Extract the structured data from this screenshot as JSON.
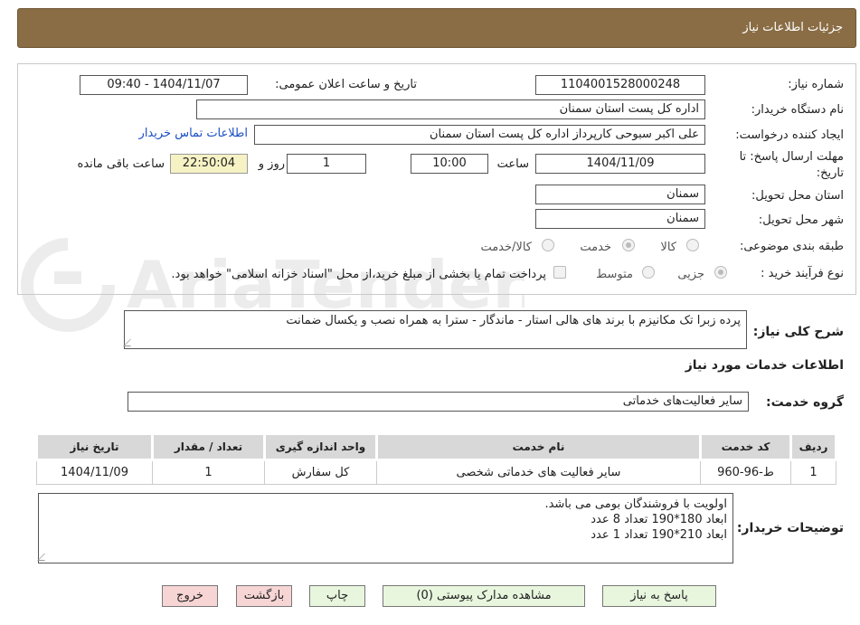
{
  "header": {
    "title": "جزئیات اطلاعات نیاز"
  },
  "form": {
    "need_number_label": "شماره نیاز:",
    "need_number": "1104001528000248",
    "announce_label": "تاریخ و ساعت اعلان عمومی:",
    "announce_value": "1404/11/07 - 09:40",
    "buyer_org_label": "نام دستگاه خریدار:",
    "buyer_org": "اداره کل پست استان سمنان",
    "creator_label": "ایجاد کننده درخواست:",
    "creator": "علی اکبر سبوحی کارپرداز اداره کل پست استان سمنان",
    "contact_link": "اطلاعات تماس خریدار",
    "deadline_label": "مهلت ارسال پاسخ: تا تاریخ:",
    "deadline_date": "1404/11/09",
    "time_label": "ساعت",
    "deadline_time": "10:00",
    "days_value": "1",
    "days_label": "روز و",
    "remaining_time": "22:50:04",
    "remaining_label": "ساعت باقی مانده",
    "province_label": "استان محل تحویل:",
    "province": "سمنان",
    "city_label": "شهر محل تحویل:",
    "city": "سمنان",
    "category_label": "طبقه بندی موضوعی:",
    "category_options": [
      "کالا",
      "خدمت",
      "کالا/خدمت"
    ],
    "purchase_type_label": "نوع فرآیند خرید :",
    "purchase_options": [
      "جزیی",
      "متوسط"
    ],
    "payment_note": "پرداخت تمام یا بخشی از مبلغ خرید،از محل \"اسناد خزانه اسلامی\" خواهد بود."
  },
  "summary": {
    "label": "شرح کلی نیاز:",
    "text": "پرده زبرا تک مکانیزم با برند های هالی استار - ماندگار - سترا به همراه نصب و یکسال ضمانت"
  },
  "services": {
    "section_title": "اطلاعات خدمات مورد نیاز",
    "group_label": "گروه خدمت:",
    "group_value": "سایر فعالیت‌های خدماتی",
    "columns": [
      "ردیف",
      "کد خدمت",
      "نام خدمت",
      "واحد اندازه گیری",
      "تعداد / مقدار",
      "تاریخ نیاز"
    ],
    "rows": [
      [
        "1",
        "ط-96-960",
        "سایر فعالیت های خدماتی شخصی",
        "کل سفارش",
        "1",
        "1404/11/09"
      ]
    ]
  },
  "buyer_notes": {
    "label": "توضیحات خریدار:",
    "lines": [
      "اولویت با فروشندگان بومی می باشد.",
      "ابعاد 180*190 تعداد 8 عدد",
      "ابعاد 210*190 تعداد 1 عدد"
    ]
  },
  "buttons": {
    "reply": "پاسخ به نیاز",
    "attachments": "مشاهده مدارک پیوستی (0)",
    "print": "چاپ",
    "back": "بازگشت",
    "exit": "خروج"
  },
  "watermark_text": "AriaTender.neT"
}
